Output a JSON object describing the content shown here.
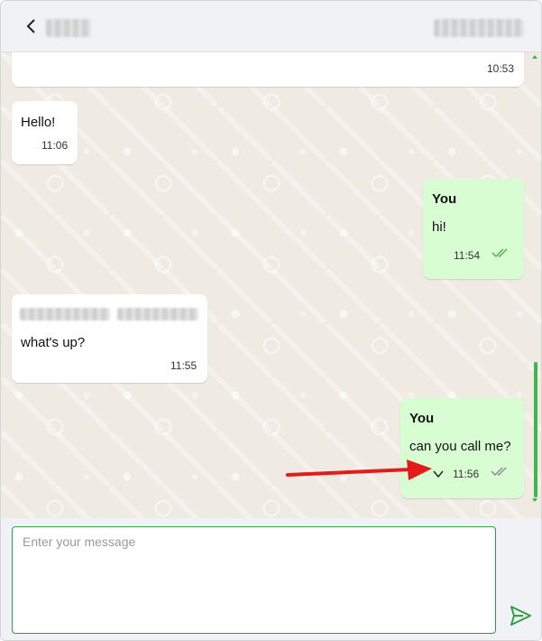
{
  "header": {
    "back_icon": "chevron-left-icon",
    "contact_name": "",
    "contact_phone": ""
  },
  "messages": [
    {
      "direction": "in",
      "sender": "",
      "text": "",
      "time": "10:53"
    },
    {
      "direction": "in",
      "sender": "",
      "text": "Hello!",
      "time": "11:06"
    },
    {
      "direction": "out",
      "sender": "You",
      "text": "hi!",
      "time": "11:54",
      "status_icon": "double-check-icon",
      "status_color": "#4caf50"
    },
    {
      "direction": "in",
      "sender": "",
      "text": "what's up?",
      "time": "11:55"
    },
    {
      "direction": "out",
      "sender": "You",
      "text": "can you call me?",
      "time": "11:56",
      "menu_icon": "chevron-down-icon",
      "status_icon": "double-check-icon",
      "status_color": "#8a8a8a"
    }
  ],
  "composer": {
    "placeholder": "Enter your message",
    "value": "",
    "send_icon": "send-icon"
  },
  "colors": {
    "accent": "#2ea043",
    "outgoing_bubble": "#d9fdd3",
    "incoming_bubble": "#ffffff",
    "chat_background": "#efeae2",
    "annotation_arrow": "#e31b1b"
  }
}
